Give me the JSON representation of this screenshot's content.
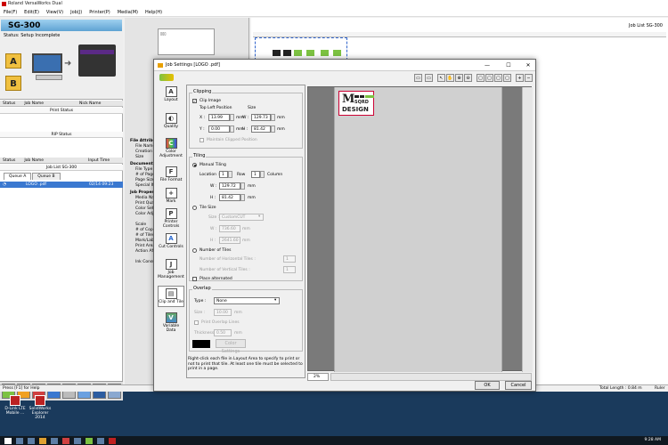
{
  "app": {
    "title": "Roland VersaWorks Dual",
    "menu": [
      "File(F)",
      "Edit(E)",
      "View(V)",
      "Job(J)",
      "Printer(P)",
      "Media(M)",
      "Help(H)"
    ]
  },
  "printer": {
    "name": "SG-300",
    "status": "Status: Setup Incomplete",
    "btn_a": "A",
    "btn_b": "B"
  },
  "queues": {
    "print": {
      "columns": [
        "Status",
        "Job Name",
        "Nick Name"
      ],
      "title": "Print Status"
    },
    "rip": {
      "title": "RIP Status"
    },
    "joblist": {
      "columns": [
        "Status",
        "Job Name",
        "Input Time"
      ],
      "title": "Job List SG-300",
      "tabs": [
        "Queue A",
        "Queue B"
      ],
      "rows": [
        {
          "name": "LOGO .pdf",
          "time": "02/14 09:23"
        }
      ]
    }
  },
  "attributes": {
    "file_heading": "File Attribu",
    "file_fields": [
      "File Name",
      "Creation D",
      "Size"
    ],
    "doc_heading": "Document I",
    "doc_fields": [
      "File Type",
      "# of Pages",
      "Page Size",
      "Special Ite"
    ],
    "job_heading": "Job Propert",
    "job_fields": [
      "Media Nam",
      "Print Quali",
      "Color Settin",
      "Color Adju",
      "",
      "Scale",
      "# of Copies",
      "# of Tiles",
      "Mark/Labe",
      "Print Area",
      "Action Afte",
      "",
      "Ink Consu"
    ]
  },
  "layout_area": {
    "title": "Job List SG-300"
  },
  "statusbar": {
    "help": "Press [F1] for Help",
    "total_length": "Total Length : 0.84 m",
    "ruler": "Ruler"
  },
  "desktop": {
    "icons": [
      {
        "label": "D-Link LTE Mobile ..."
      },
      {
        "label": "SolidWorks Explorer 2014"
      }
    ],
    "clock": "9:28 AM"
  },
  "dialog": {
    "title": "Job Settings [LOGO .pdf]",
    "sidebar": [
      {
        "label": "Layout",
        "glyph": "A"
      },
      {
        "label": "Quality",
        "glyph": "◐"
      },
      {
        "label": "Color Adjustment",
        "glyph": "C"
      },
      {
        "label": "File Format",
        "glyph": "F"
      },
      {
        "label": "Mark",
        "glyph": "+"
      },
      {
        "label": "Printer Controls",
        "glyph": "P"
      },
      {
        "label": "Cut Controls",
        "glyph": "A"
      },
      {
        "label": "Job Management",
        "glyph": "J"
      },
      {
        "label": "Clip and Tile",
        "glyph": "▤"
      },
      {
        "label": "Variable Data",
        "glyph": "V"
      }
    ],
    "clipping": {
      "label": "Clipping",
      "clip_image": "Clip Image",
      "top_left_position": "Top Left Position",
      "size": "Size",
      "x_label": "X :",
      "x_value": "13.99",
      "y_label": "Y :",
      "y_value": "0.00",
      "w_label": "W :",
      "w_value": "129.73",
      "h_label": "H :",
      "h_value": "81.42",
      "unit": "mm",
      "maintain": "Maintain Clipped Position"
    },
    "tiling": {
      "label": "Tiling",
      "manual": "Manual Tiling",
      "location": "Location :",
      "location_value": "1",
      "row": "Row",
      "row_value": "1",
      "column": "Column",
      "w_label": "W :",
      "w_value": "129.72",
      "h_label": "H :",
      "h_value": "81.42",
      "unit": "mm",
      "tile_size": "Tile Size",
      "size_label": "Size :",
      "size_value": "CustomCUT",
      "ts_w": "736.60",
      "ts_h": "2641.60",
      "num_tiles": "Number of Tiles",
      "num_horizontal": "Number of Horizontal Tiles :",
      "num_horizontal_value": "1",
      "num_vertical": "Number of Vertical Tiles :",
      "num_vertical_value": "1",
      "alternated": "Place alternated"
    },
    "overlap": {
      "label": "Overlap",
      "type_label": "Type :",
      "type_value": "None",
      "size_label": "Size :",
      "size_value": "10.00",
      "print_lines": "Print Overlap Lines",
      "thickness_label": "Thickness :",
      "thickness_value": "0.50",
      "unit": "mm",
      "color_settings": "Color Settings"
    },
    "hint": "Right-click each file in Layout Area to specify to print or not to print that tile. At least one tile must be selected to print in a page.",
    "logo": {
      "m": "M",
      "line1": "SQRD",
      "line2": "DESIGN"
    },
    "zoom": "2%",
    "ok": "OK",
    "cancel": "Cancel"
  },
  "colors": {
    "accent": "#3a78d0",
    "logo_green": "#7cc242",
    "logo_red": "#c03",
    "desktop": "#1a3a5c"
  }
}
